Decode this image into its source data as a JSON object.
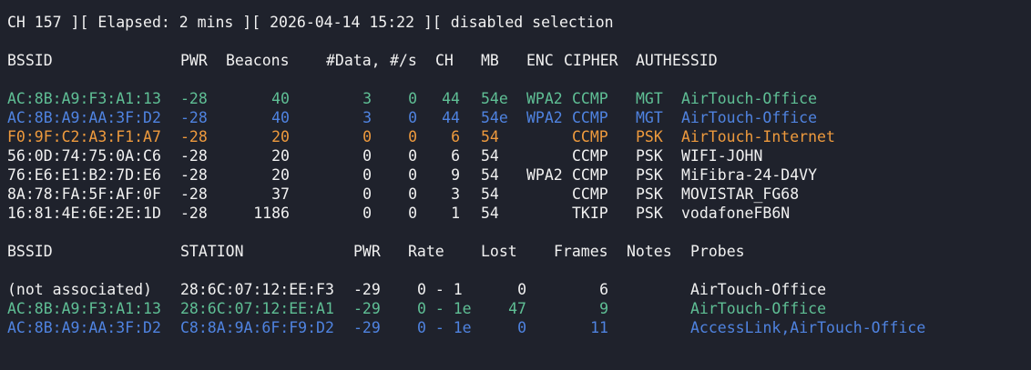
{
  "status_line": "CH 157 ][ Elapsed: 2 mins ][ 2026-04-14 15:22 ][ disabled selection",
  "colors": {
    "background": "#1f222c",
    "text": "#f1f1f1",
    "green": "#5fbf95",
    "blue": "#4f83e0",
    "orange": "#ee9a3d"
  },
  "ap_table": {
    "headers": {
      "bssid": "BSSID",
      "pwr": "PWR",
      "beacons": "Beacons",
      "data": "#Data,",
      "per_sec": "#/s",
      "ch": "CH",
      "mb": "MB",
      "enc": "ENC",
      "cipher": "CIPHER",
      "auth": "AUTH",
      "essid": "ESSID"
    },
    "rows": [
      {
        "color": "green",
        "bssid": "AC:8B:A9:F3:A1:13",
        "pwr": "-28",
        "beacons": "40",
        "data": "3",
        "per_sec": "0",
        "ch": "44",
        "mb": "54e",
        "enc": "WPA2",
        "cipher": "CCMP",
        "auth": "MGT",
        "essid": "AirTouch-Office"
      },
      {
        "color": "blue",
        "bssid": "AC:8B:A9:AA:3F:D2",
        "pwr": "-28",
        "beacons": "40",
        "data": "3",
        "per_sec": "0",
        "ch": "44",
        "mb": "54e",
        "enc": "WPA2",
        "cipher": "CCMP",
        "auth": "MGT",
        "essid": "AirTouch-Office"
      },
      {
        "color": "orange",
        "bssid": "F0:9F:C2:A3:F1:A7",
        "pwr": "-28",
        "beacons": "20",
        "data": "0",
        "per_sec": "0",
        "ch": "6",
        "mb": "54",
        "enc": "",
        "cipher": "CCMP",
        "auth": "PSK",
        "essid": "AirTouch-Internet"
      },
      {
        "color": "white",
        "bssid": "56:0D:74:75:0A:C6",
        "pwr": "-28",
        "beacons": "20",
        "data": "0",
        "per_sec": "0",
        "ch": "6",
        "mb": "54",
        "enc": "",
        "cipher": "CCMP",
        "auth": "PSK",
        "essid": "WIFI-JOHN"
      },
      {
        "color": "white",
        "bssid": "76:E6:E1:B2:7D:E6",
        "pwr": "-28",
        "beacons": "20",
        "data": "0",
        "per_sec": "0",
        "ch": "9",
        "mb": "54",
        "enc": "WPA2",
        "cipher": "CCMP",
        "auth": "PSK",
        "essid": "MiFibra-24-D4VY"
      },
      {
        "color": "white",
        "bssid": "8A:78:FA:5F:AF:0F",
        "pwr": "-28",
        "beacons": "37",
        "data": "0",
        "per_sec": "0",
        "ch": "3",
        "mb": "54",
        "enc": "",
        "cipher": "CCMP",
        "auth": "PSK",
        "essid": "MOVISTAR_FG68"
      },
      {
        "color": "white",
        "bssid": "16:81:4E:6E:2E:1D",
        "pwr": "-28",
        "beacons": "1186",
        "data": "0",
        "per_sec": "0",
        "ch": "1",
        "mb": "54",
        "enc": "",
        "cipher": "TKIP",
        "auth": "PSK",
        "essid": "vodafoneFB6N"
      }
    ]
  },
  "station_table": {
    "headers": {
      "bssid": "BSSID",
      "station": "STATION",
      "pwr": "PWR",
      "rate": "Rate",
      "lost": "Lost",
      "frames": "Frames",
      "notes": "Notes",
      "probes": "Probes"
    },
    "rows": [
      {
        "color": "white",
        "bssid": "(not associated)",
        "station": "28:6C:07:12:EE:F3",
        "pwr": "-29",
        "rate": "0 - 1",
        "lost": "0",
        "frames": "6",
        "notes": "",
        "probes": "AirTouch-Office"
      },
      {
        "color": "green",
        "bssid": "AC:8B:A9:F3:A1:13",
        "station": "28:6C:07:12:EE:A1",
        "pwr": "-29",
        "rate": "0 - 1e",
        "lost": "47",
        "frames": "9",
        "notes": "",
        "probes": "AirTouch-Office"
      },
      {
        "color": "blue",
        "bssid": "AC:8B:A9:AA:3F:D2",
        "station": "C8:8A:9A:6F:F9:D2",
        "pwr": "-29",
        "rate": "0 - 1e",
        "lost": "0",
        "frames": "11",
        "notes": "",
        "probes": "AccessLink,AirTouch-Office"
      }
    ]
  }
}
